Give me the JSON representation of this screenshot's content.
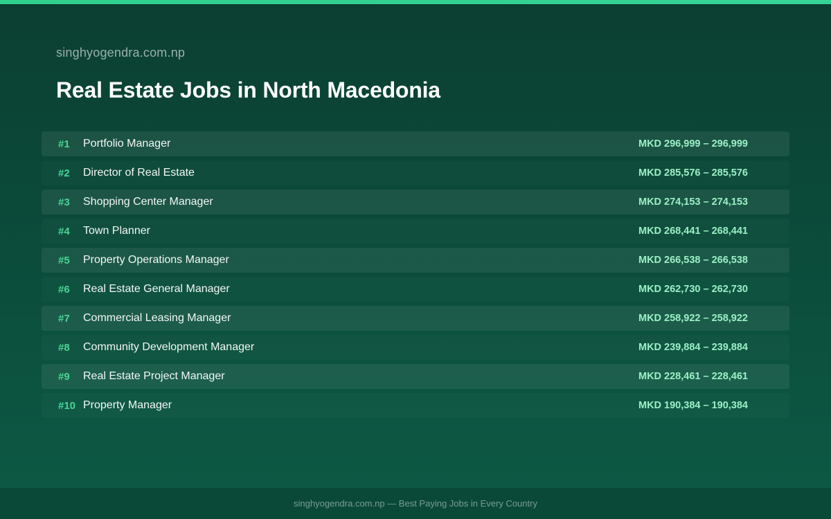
{
  "header": {
    "site_name": "singhyogendra.com.np",
    "title": "Real Estate Jobs in North Macedonia"
  },
  "jobs": [
    {
      "rank": "#1",
      "title": "Portfolio Manager",
      "salary": "MKD 296,999 – 296,999"
    },
    {
      "rank": "#2",
      "title": "Director of Real Estate",
      "salary": "MKD 285,576 – 285,576"
    },
    {
      "rank": "#3",
      "title": "Shopping Center Manager",
      "salary": "MKD 274,153 – 274,153"
    },
    {
      "rank": "#4",
      "title": "Town Planner",
      "salary": "MKD 268,441 – 268,441"
    },
    {
      "rank": "#5",
      "title": "Property Operations Manager",
      "salary": "MKD 266,538 – 266,538"
    },
    {
      "rank": "#6",
      "title": "Real Estate General Manager",
      "salary": "MKD 262,730 – 262,730"
    },
    {
      "rank": "#7",
      "title": "Commercial Leasing Manager",
      "salary": "MKD 258,922 – 258,922"
    },
    {
      "rank": "#8",
      "title": "Community Development Manager",
      "salary": "MKD 239,884 – 239,884"
    },
    {
      "rank": "#9",
      "title": "Real Estate Project Manager",
      "salary": "MKD 228,461 – 228,461"
    },
    {
      "rank": "#10",
      "title": "Property Manager",
      "salary": "MKD 190,384 – 190,384"
    }
  ],
  "footer": {
    "text": "singhyogendra.com.np — Best Paying Jobs in Every Country"
  },
  "colors": {
    "accent": "#36d497",
    "rank": "#49d596",
    "salary": "#9bf0c6",
    "background_top": "#0b3f31",
    "background_bottom": "#0d5a45"
  }
}
